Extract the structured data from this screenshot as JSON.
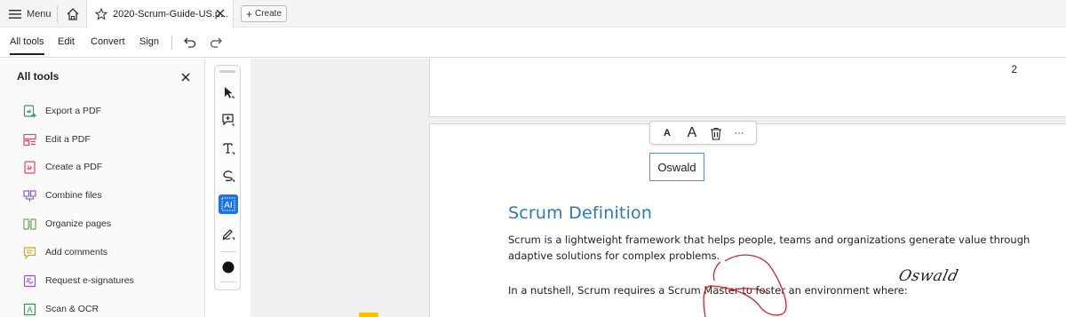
{
  "topbar": {
    "menu_label": "Menu",
    "tab_title": "2020-Scrum-Guide-US.p...",
    "create_label": "Create"
  },
  "menubar": {
    "items": [
      "All tools",
      "Edit",
      "Convert",
      "Sign"
    ],
    "active_item": "All tools"
  },
  "left_panel": {
    "title": "All tools",
    "tools": [
      {
        "label": "Export a PDF",
        "icon": "export-pdf-icon",
        "color": "#2e9a8f"
      },
      {
        "label": "Edit a PDF",
        "icon": "edit-pdf-icon",
        "color": "#e0457b"
      },
      {
        "label": "Create a PDF",
        "icon": "create-pdf-icon",
        "color": "#e34850"
      },
      {
        "label": "Combine files",
        "icon": "combine-files-icon",
        "color": "#7a4fd6"
      },
      {
        "label": "Organize pages",
        "icon": "organize-pages-icon",
        "color": "#5aa83c"
      },
      {
        "label": "Add comments",
        "icon": "add-comments-icon",
        "color": "#d8a800"
      },
      {
        "label": "Request e-signatures",
        "icon": "request-esignatures-icon",
        "color": "#9a4fd6"
      },
      {
        "label": "Scan & OCR",
        "icon": "scan-ocr-icon",
        "color": "#2e9a4a"
      }
    ]
  },
  "vertical_toolbar": {
    "tools": [
      "select-icon",
      "add-comment-icon",
      "add-text-icon",
      "draw-icon",
      "text-select-icon",
      "sign-icon",
      "color-icon"
    ],
    "selected": "text-select-icon"
  },
  "document": {
    "page_number": "2",
    "format_bar": {
      "small_a": "A",
      "large_a": "A",
      "more": "···"
    },
    "textbox_value": "Oswald",
    "heading": "Scrum Definition",
    "paragraph_lines": [
      "Scrum is a lightweight framework that helps people, teams and organizations generate value through",
      "adaptive solutions for complex problems.",
      "In a nutshell, Scrum requires a Scrum Master to foster an environment where:"
    ],
    "signature": "Oswald"
  },
  "colors": {
    "heading_blue": "#2c79b8",
    "selected_tool": "#1a73e8",
    "ink_red": "#d9202a"
  }
}
